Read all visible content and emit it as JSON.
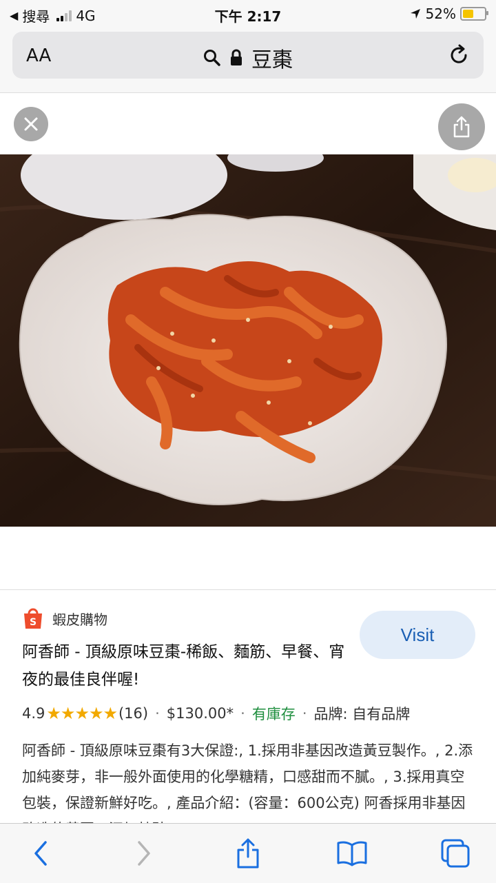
{
  "status_bar": {
    "back_app": "搜尋",
    "network": "4G",
    "time": "下午 2:17",
    "battery": "52%",
    "battery_level": 0.52
  },
  "address_bar": {
    "text_size_label": "AA",
    "query": "豆棗"
  },
  "product": {
    "store_name": "蝦皮購物",
    "visit_label": "Visit",
    "title": "阿香師 - 頂級原味豆棗-稀飯、麵筋、早餐、宵夜的最佳良伴喔!",
    "rating": "4.9",
    "stars": "★★★★★",
    "review_count": "(16)",
    "separator": "·",
    "price": "$130.00*",
    "stock": "有庫存",
    "brand": "品牌: 自有品牌",
    "description": "阿香師 - 頂級原味豆棗有3大保證:, 1.採用非基因改造黃豆製作。, 2.添加純麥芽，非一般外面使用的化學糖精，口感甜而不膩。, 3.採用真空包裝，保證新鮮好吃。, 產品介紹：(容量：600公克) 阿香採用非基因改造的黃豆，添加特砂"
  },
  "colors": {
    "accent": "#1a5fb4",
    "stars": "#f2a900",
    "stock": "#1e8e3e",
    "shopee": "#ee4d2d"
  }
}
